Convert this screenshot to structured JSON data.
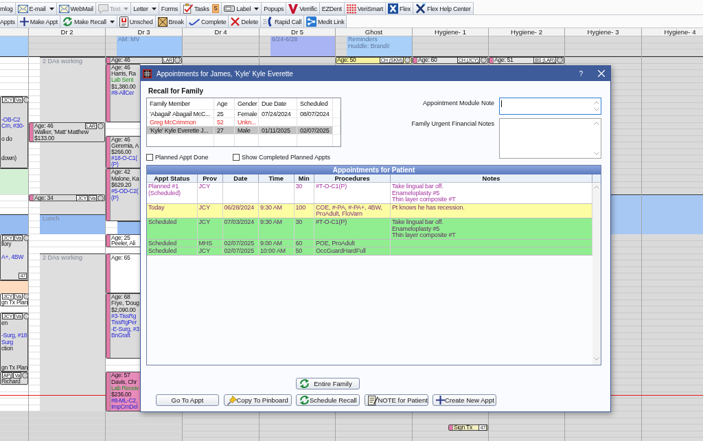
{
  "toolbars": [
    {
      "items": [
        {
          "label": "mlog",
          "dropdown": false,
          "disabled": false
        },
        {
          "label": "E-mail",
          "dropdown": true,
          "disabled": false
        },
        {
          "label": "WebMail",
          "dropdown": false,
          "disabled": false
        },
        {
          "label": "Text",
          "dropdown": true,
          "disabled": true
        },
        {
          "label": "Letter",
          "dropdown": true,
          "disabled": false
        },
        {
          "label": "Forms",
          "dropdown": false,
          "disabled": false
        },
        {
          "label": "Tasks",
          "dropdown": false,
          "disabled": false,
          "badge": "5"
        },
        {
          "label": "Label",
          "dropdown": true,
          "disabled": false
        },
        {
          "label": "Popups",
          "dropdown": false,
          "disabled": false
        },
        {
          "label": "Verrific",
          "dropdown": false,
          "disabled": false
        },
        {
          "label": "EZDent",
          "dropdown": false,
          "disabled": false
        },
        {
          "label": "VeriSmart",
          "dropdown": false,
          "disabled": false
        },
        {
          "label": "Flex",
          "dropdown": false,
          "disabled": false
        },
        {
          "label": "Flex Help Center",
          "dropdown": false,
          "disabled": false
        }
      ]
    },
    {
      "items": [
        {
          "label": "Appts",
          "dropdown": false,
          "disabled": false
        },
        {
          "label": "Make Appt",
          "dropdown": false,
          "disabled": false
        },
        {
          "label": "Make Recall",
          "dropdown": true,
          "disabled": false
        },
        {
          "label": "Unsched",
          "dropdown": false,
          "disabled": false
        },
        {
          "label": "Break",
          "dropdown": false,
          "disabled": false
        },
        {
          "label": "Complete",
          "dropdown": false,
          "disabled": false
        },
        {
          "label": "Delete",
          "dropdown": false,
          "disabled": false
        },
        {
          "label": "Rapid Call",
          "dropdown": false,
          "disabled": false
        },
        {
          "label": "Medit Link",
          "dropdown": false,
          "disabled": false
        }
      ]
    }
  ],
  "schedule": {
    "columns": [
      {
        "notes": [
          {
            "color": "#a8d0f8"
          }
        ],
        "blocks": [
          {
            "kind": "appointment",
            "color": "#dcdcdc",
            "tags": [
              "JCY",
              "Va"
            ],
            "lines": [
              {
                "text": "-OB-C2",
                "kind": "procedure"
              },
              {
                "text": "Crn, #30-",
                "kind": "procedure"
              },
              {
                "text": "o do",
                "kind": "text"
              },
              {
                "text": "down)",
                "kind": "text"
              }
            ]
          },
          {
            "kind": "blockout",
            "color": "#d4f0d4"
          },
          {
            "kind": "blockout",
            "color": "#96bcf2"
          },
          {
            "kind": "appointment",
            "color": "#e2e2e2",
            "tags": [
              "JCY",
              "Va"
            ],
            "lines": [
              {
                "text": "llory",
                "kind": "text"
              },
              {
                "text": "A+, 4BW",
                "kind": "procedure"
              }
            ],
            "corner_tag": "47"
          },
          {
            "kind": "blockout",
            "color": "#ffdcc0"
          },
          {
            "kind": "appointment",
            "color": "#ffffff",
            "tags": [
              "JCY",
              "Va"
            ],
            "lines": [
              {
                "text": "gn Tx Plan",
                "kind": "text"
              }
            ]
          },
          {
            "kind": "appointment",
            "color": "#dcdcdc",
            "tags": [
              "JCY",
              "Va"
            ],
            "lines": [
              {
                "text": "en",
                "kind": "text"
              },
              {
                "text": "-Surg, #18",
                "kind": "procedure"
              },
              {
                "text": "Surg",
                "kind": "procedure"
              },
              {
                "text": "ction",
                "kind": "text"
              },
              {
                "text": "gn Tx Plan",
                "kind": "text"
              }
            ]
          },
          {
            "kind": "appointment",
            "color": "#dcdcdc",
            "tags": [
              "AP)",
              "Va"
            ],
            "lines": [
              {
                "text": "Richard",
                "kind": "text"
              }
            ]
          }
        ]
      },
      {
        "header": "Dr 2",
        "blocks": [
          {
            "kind": "blockout",
            "color": "#dedede",
            "label": "2 DAs working"
          },
          {
            "kind": "appointment",
            "color": "#dcdcdc",
            "header": "Age: 46",
            "tags": [
              "LAR"
            ],
            "lines": [
              {
                "text": "Walker, 'Matt' Matthew",
                "kind": "text"
              },
              {
                "text": "$133.00",
                "kind": "text"
              }
            ]
          },
          {
            "kind": "appointment",
            "color": "#dcdcdc",
            "header": "Age: 34",
            "tags": [
              "JCY",
              "Va"
            ]
          },
          {
            "kind": "blockout",
            "color": "#96bcf2",
            "label": "Lunch"
          },
          {
            "kind": "blockout",
            "color": "#dedede",
            "label": "2 DAs working"
          }
        ]
      },
      {
        "header": "Dr 3",
        "notes": [
          {
            "color": "#a0c8f8",
            "lines": [
              "AM: MV"
            ]
          }
        ],
        "blocks": [
          {
            "kind": "appointment",
            "color": "#dcdcdc",
            "header": "Age: 46",
            "tags": [
              "LAR"
            ]
          },
          {
            "kind": "appointment",
            "color": "#dcdcdc",
            "header": "Age: 46",
            "lines": [
              {
                "text": "Harris, Ra",
                "kind": "text"
              },
              {
                "text": "Lab Sent",
                "kind": "lab"
              },
              {
                "text": "$1,380.00",
                "kind": "text"
              },
              {
                "text": "#8-AllCer",
                "kind": "procedure"
              }
            ]
          },
          {
            "kind": "appointment",
            "color": "#dcdcdc",
            "header": "Age: 46",
            "lines": [
              {
                "text": "Geremia, A",
                "kind": "text"
              },
              {
                "text": "$266.00",
                "kind": "text"
              },
              {
                "text": "#18-O-C1(",
                "kind": "procedure"
              },
              {
                "text": "(P)",
                "kind": "procedure"
              }
            ]
          },
          {
            "kind": "appointment",
            "color": "#dcdcdc",
            "header": "Age: 42",
            "lines": [
              {
                "text": "Malone, Ka",
                "kind": "text"
              },
              {
                "text": "$629.20",
                "kind": "text"
              },
              {
                "text": "#5-OD-C2(",
                "kind": "procedure"
              },
              {
                "text": "(P)",
                "kind": "procedure"
              }
            ]
          },
          {
            "kind": "blockout",
            "color": "#96bcf2"
          },
          {
            "kind": "appointment",
            "color": "#ffffff",
            "header": "Age: 25",
            "lines": [
              {
                "text": "Peeler, Ali",
                "kind": "text"
              }
            ]
          },
          {
            "kind": "appointment",
            "color": "#ffffff",
            "header": "Age: 65"
          },
          {
            "kind": "appointment",
            "color": "#dcdcdc",
            "header": "Age: 68",
            "lines": [
              {
                "text": "Frye, 'Doug",
                "kind": "text"
              },
              {
                "text": "$2,090.00",
                "kind": "text"
              },
              {
                "text": "#3-TissRg",
                "kind": "procedure"
              },
              {
                "text": "TissRgPer",
                "kind": "procedure"
              },
              {
                "text": "-E-Surg, #3",
                "kind": "procedure"
              },
              {
                "text": "BnGraft",
                "kind": "procedure"
              }
            ]
          },
          {
            "kind": "appointment",
            "color": "#e88cbc",
            "header": "Age: 57",
            "lines": [
              {
                "text": "Davis, Chr",
                "kind": "text"
              },
              {
                "text": "Lab Receiv",
                "kind": "lab"
              },
              {
                "text": "$236.00",
                "kind": "text"
              },
              {
                "text": "#8-ML-C2,",
                "kind": "procedure"
              },
              {
                "text": "ImpCrnDel",
                "kind": "procedure"
              }
            ]
          }
        ]
      },
      {
        "header": "Dr 4"
      },
      {
        "header": "Dr 5",
        "notes": [
          {
            "color": "#a8b4f4",
            "lines": [
              "6/24-6/28"
            ]
          }
        ]
      },
      {
        "header": "Ghost",
        "notes": [
          {
            "color": "#a8d0f8",
            "lines": [
              "Reminders",
              "Huddle: Brandi!"
            ]
          }
        ],
        "blocks": [
          {
            "kind": "appointment",
            "color": "#f6f2a0",
            "header": "Age: 50",
            "tags": [
              "CH (SKM)"
            ]
          }
        ]
      },
      {
        "header": "Hygiene- 1",
        "blocks": [
          {
            "kind": "appointment",
            "color": "#e6e6e6",
            "header": "Age: 60",
            "tags": [
              "CH (JCY)"
            ]
          },
          {
            "kind": "appointment",
            "color": "#f4f0c4",
            "lines": [
              {
                "text": "Sign Tx",
                "kind": "text"
              }
            ],
            "corner_tag": "47"
          }
        ]
      },
      {
        "header": "Hygiene- 2",
        "blocks": [
          {
            "kind": "appointment",
            "color": "#e6e6e6",
            "header": "Age: 51",
            "tags": [
              "BS (LAR)"
            ]
          }
        ]
      },
      {
        "header": "Hygiene- 3",
        "blocks": [
          {
            "kind": "blockout",
            "color": "#a8c8f4"
          }
        ]
      },
      {
        "header": "Hygiene- 4",
        "blocks": [
          {
            "kind": "blockout",
            "color": "#a8c8f4"
          }
        ]
      }
    ]
  },
  "dialog": {
    "title": "Appointments for James, 'Kyle' Kyle Everette",
    "help_button": "?",
    "recall_family": {
      "title": "Recall for Family",
      "columns": [
        "Family Member",
        "Age",
        "Gender",
        "Due Date",
        "Scheduled"
      ],
      "rows": [
        {
          "member": "'Abagail' Abagail McC...",
          "age": "25",
          "gender": "Female",
          "due_date": "07/24/2024",
          "scheduled": "08/07/2024",
          "flagged": false,
          "selected": false
        },
        {
          "member": "Greg McCrimmon",
          "age": "52",
          "gender": "Unkn...",
          "flagged": true,
          "selected": false
        },
        {
          "member": "'Kyle' Kyle Everette J...",
          "age": "27",
          "gender": "Male",
          "due_date": "01/11/2025",
          "scheduled": "02/07/2025",
          "flagged": false,
          "selected": true
        }
      ]
    },
    "checkboxes": [
      {
        "label": "Planned Appt Done",
        "checked": false
      },
      {
        "label": "Show Completed Planned Appts",
        "checked": false
      }
    ],
    "note_fields": [
      {
        "label": "Appointment Module Note",
        "focused": true
      },
      {
        "label": "Family Urgent Financial Notes",
        "focused": false
      }
    ],
    "appointments": {
      "title": "Appointments for Patient",
      "columns": [
        "Appt Status",
        "Prov",
        "Date",
        "Time",
        "Min",
        "Procedures",
        "Notes"
      ],
      "rows": [
        {
          "kind": "planned",
          "selected": false,
          "status": "Planned #1 (Scheduled)",
          "prov": "JCY",
          "min": "30",
          "procedures": "#T-O-C1(P)",
          "notes": "Take lingual bar off.\nEnameloplasty #5\nThin layer composite #T"
        },
        {
          "kind": "today",
          "selected": false,
          "status": "Today",
          "prov": "JCY",
          "date": "06/28/2024",
          "time": "9:30 AM",
          "min": "100",
          "procedures": "COE, #-PA, #-PA+, 4BW, ProAdult, FloVarn",
          "notes": "Pt knows he has recession."
        },
        {
          "kind": "scheduled",
          "selected": false,
          "status": "Scheduled",
          "prov": "JCY",
          "date": "07/03/2024",
          "time": "9:30 AM",
          "min": "30",
          "procedures": "#T-O-C1(P)",
          "notes": "Take lingual bar off.\nEnameloplasty #5\nThin layer composite #T"
        },
        {
          "kind": "scheduled",
          "selected": false,
          "status": "Scheduled",
          "prov": "MHS",
          "date": "02/07/2025",
          "time": "9:00 AM",
          "min": "60",
          "procedures": "POE, ProAdult"
        },
        {
          "kind": "scheduled",
          "selected": false,
          "status": "Scheduled",
          "prov": "JCY",
          "date": "02/07/2025",
          "time": "10:00 AM",
          "min": "50",
          "procedures": "OccGuardHardFull"
        }
      ]
    },
    "buttons": [
      {
        "label": "Entire Family"
      },
      {
        "label": "Go To Appt"
      },
      {
        "label": "Copy To Pinboard"
      },
      {
        "label": "Schedule Recall"
      },
      {
        "label": "NOTE for Patient"
      },
      {
        "label": "Create New Appt"
      }
    ]
  }
}
